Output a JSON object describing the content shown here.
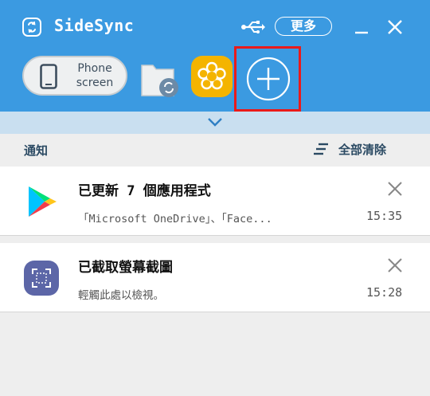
{
  "app": {
    "title": "SideSync",
    "more_label": "更多",
    "phone_screen_line1": "Phone",
    "phone_screen_line2": "screen"
  },
  "notifications": {
    "section_title": "通知",
    "clear_all_label": "全部清除",
    "items": [
      {
        "title": "已更新 7 個應用程式",
        "text": "「Microsoft OneDrive」、「Face...",
        "time": "15:35",
        "icon": "google-play-icon"
      },
      {
        "title": "已截取螢幕截圖",
        "text": "輕觸此處以檢視。",
        "time": "15:28",
        "icon": "screenshot-icon"
      }
    ]
  },
  "colors": {
    "header_bg": "#3b9ae1",
    "expand_bar": "#c9dff0",
    "highlight": "#ea1a1a",
    "photo_accent": "#f4b400",
    "text_accent": "#2b4a63"
  },
  "icons": [
    "sidesync-logo-icon",
    "usb-icon",
    "minimize-icon",
    "close-icon",
    "phone-icon",
    "folder-sync-icon",
    "photo-flower-icon",
    "add-icon",
    "chevron-down-icon",
    "clear-all-icon"
  ]
}
